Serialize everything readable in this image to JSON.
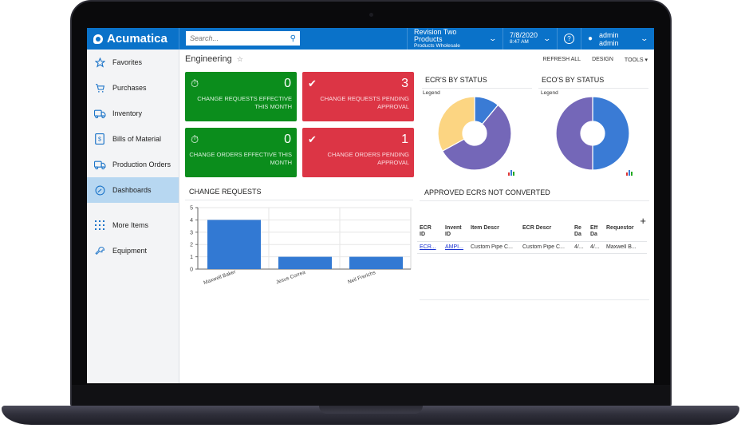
{
  "app": {
    "brand": "Acumatica",
    "search_placeholder": "Search...",
    "company": {
      "name": "Revision Two Products",
      "branch": "Products Wholesale"
    },
    "datetime": {
      "date": "7/8/2020",
      "time": "8:47 AM"
    },
    "user": "admin admin"
  },
  "sidebar": {
    "items": [
      {
        "label": "Favorites",
        "icon": "star-icon"
      },
      {
        "label": "Purchases",
        "icon": "cart-icon"
      },
      {
        "label": "Inventory",
        "icon": "truck-icon"
      },
      {
        "label": "Bills of Material",
        "icon": "document-dollar-icon"
      },
      {
        "label": "Production Orders",
        "icon": "truck-icon"
      },
      {
        "label": "Dashboards",
        "icon": "gauge-icon",
        "active": true
      },
      {
        "label": "More Items",
        "icon": "grid-dots-icon"
      },
      {
        "label": "Equipment",
        "icon": "wrench-icon"
      }
    ]
  },
  "page": {
    "title": "Engineering",
    "toolbar": {
      "refresh_all": "REFRESH ALL",
      "design": "DESIGN",
      "tools": "TOOLS"
    }
  },
  "tiles": [
    {
      "value": "0",
      "label": "CHANGE REQUESTS EFFECTIVE THIS MONTH",
      "color": "#0b8d1c",
      "icon": "stopwatch-icon"
    },
    {
      "value": "3",
      "label": "CHANGE REQUESTS PENDING APPROVAL",
      "color": "#dc3545",
      "icon": "badge-check-icon"
    },
    {
      "value": "0",
      "label": "CHANGE ORDERS EFFECTIVE THIS MONTH",
      "color": "#0b8d1c",
      "icon": "stopwatch-icon"
    },
    {
      "value": "1",
      "label": "CHANGE ORDERS PENDING APPROVAL",
      "color": "#dc3545",
      "icon": "badge-check-icon"
    }
  ],
  "widgets": {
    "ecr_status_title": "ECR'S BY STATUS",
    "eco_status_title": "ECO'S BY STATUS",
    "legend_label": "Legend",
    "change_requests_title": "CHANGE REQUESTS",
    "approved_title": "APPROVED ECRS NOT CONVERTED"
  },
  "chart_data": [
    {
      "type": "bar",
      "title": "CHANGE REQUESTS",
      "categories": [
        "Maxwell Baker",
        "Jesus Correa",
        "Neil Frerichs"
      ],
      "values": [
        4,
        1,
        1
      ],
      "ylim": [
        0,
        5
      ],
      "yticks": [
        0,
        1,
        2,
        3,
        4,
        5
      ],
      "xlabel": "",
      "ylabel": "",
      "grid": true,
      "color": "#3279d3"
    },
    {
      "type": "pie",
      "title": "ECR'S BY STATUS",
      "donut": true,
      "slices": [
        {
          "value": 11,
          "color": "#3a7bd5"
        },
        {
          "value": 56,
          "color": "#7467b8"
        },
        {
          "value": 33,
          "color": "#fcd582"
        }
      ]
    },
    {
      "type": "pie",
      "title": "ECO'S BY STATUS",
      "donut": true,
      "slices": [
        {
          "value": 50,
          "color": "#3a7bd5"
        },
        {
          "value": 50,
          "color": "#7467b8"
        }
      ]
    }
  ],
  "grid": {
    "columns": [
      {
        "l1": "ECR",
        "l2": "ID"
      },
      {
        "l1": "Invent",
        "l2": "ID"
      },
      {
        "l1": "Item Descr",
        "l2": ""
      },
      {
        "l1": "ECR Descr",
        "l2": ""
      },
      {
        "l1": "Re",
        "l2": "Da"
      },
      {
        "l1": "Eff",
        "l2": "Da"
      },
      {
        "l1": "Requestor",
        "l2": ""
      }
    ],
    "rows": [
      [
        "ECR...",
        "AMPI...",
        "Custom Pipe C...",
        "Custom Pipe C...",
        "4/...",
        "4/...",
        "Maxwell B..."
      ]
    ]
  }
}
